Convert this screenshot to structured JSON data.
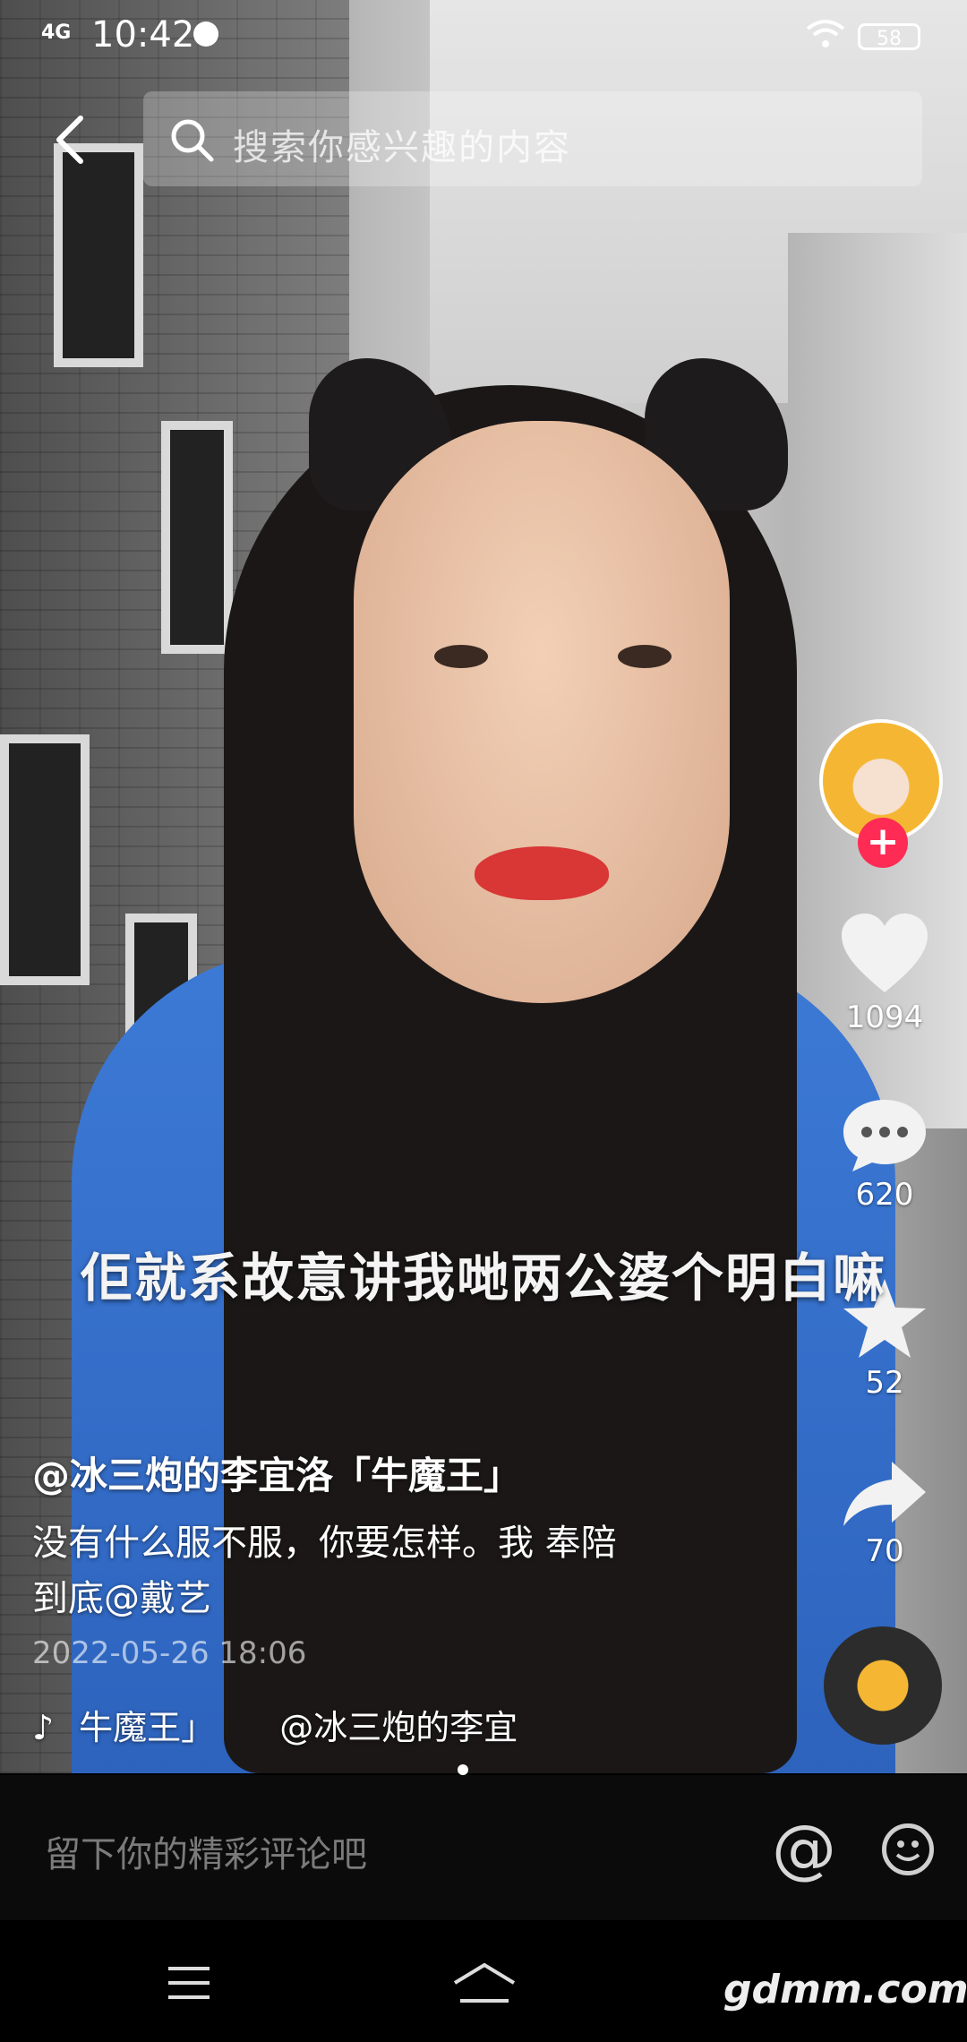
{
  "status_bar": {
    "network": "4G",
    "time": "10:42",
    "battery": "58"
  },
  "top_bar": {
    "search_placeholder": "搜索你感兴趣的内容"
  },
  "video": {
    "subtitle": "佢就系故意讲我哋两公婆个明白嘛"
  },
  "actions": {
    "likes": "1094",
    "comments": "620",
    "favorites": "52",
    "shares": "70"
  },
  "post": {
    "author": "@冰三炮的李宜洛「牛魔王」",
    "description_line1": "没有什么服不服，你要怎样。我 奉陪",
    "description_line2": "到底@戴艺",
    "date": "2022-05-26 18:06",
    "music_part1": "牛魔王」",
    "music_part2": "@冰三炮的李宜"
  },
  "comment_bar": {
    "placeholder": "留下你的精彩评论吧",
    "at_symbol": "@"
  },
  "nav_bar": {
    "watermark": "gdmm.com"
  },
  "colors": {
    "accent": "#fe2c55",
    "background": "#000000"
  }
}
